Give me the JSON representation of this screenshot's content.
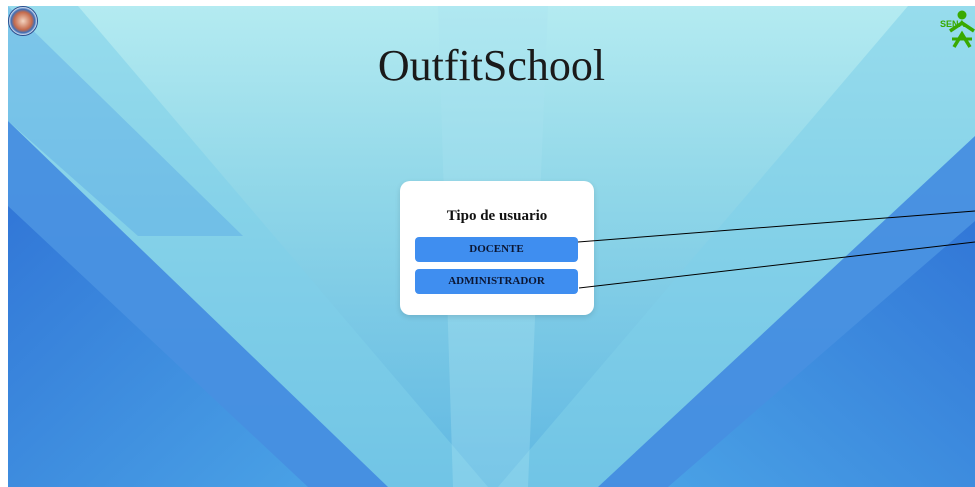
{
  "header": {
    "title": "OutfitSchool",
    "left_logo_icon": "school-crest-icon",
    "right_logo_icon": "sena-logo-icon",
    "right_logo_text": "SENA"
  },
  "login_card": {
    "heading": "Tipo de usuario",
    "buttons": [
      {
        "label": "DOCENTE"
      },
      {
        "label": "ADMINISTRADOR"
      }
    ]
  },
  "colors": {
    "button_bg": "#3f8ef0",
    "sena_green": "#39a900",
    "background_top": "#b4ebf1",
    "background_bottom": "#5fb7e2"
  }
}
